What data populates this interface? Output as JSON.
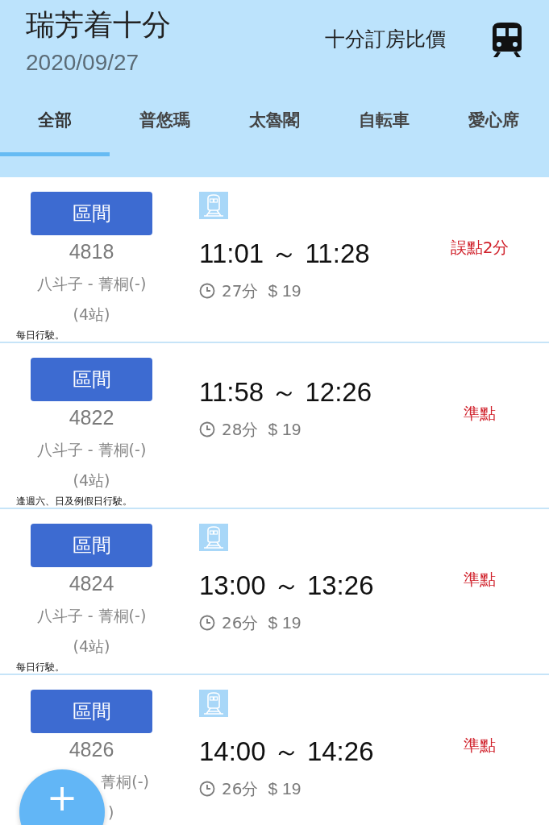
{
  "header": {
    "title": "瑞芳着十分",
    "date": "2020/09/27",
    "link": "十分訂房比價"
  },
  "tabs": [
    {
      "label": "全部",
      "selected": true
    },
    {
      "label": "普悠瑪",
      "selected": false
    },
    {
      "label": "太魯閣",
      "selected": false
    },
    {
      "label": "自転車",
      "selected": false
    },
    {
      "label": "愛心席",
      "selected": false
    }
  ],
  "trains": [
    {
      "type": "區間",
      "number": "4818",
      "route": "八斗子 - 菁桐(-)",
      "stops": "(4站)",
      "note": "每日行駛。",
      "train_icon": true,
      "times": "11:01 ～ 11:28",
      "duration": "27分",
      "fare": "$ 19",
      "status": "誤點2分",
      "covered_by_fab": false
    },
    {
      "type": "區間",
      "number": "4822",
      "route": "八斗子 - 菁桐(-)",
      "stops": "(4站)",
      "note": "逢週六、日及例假日行駛。",
      "train_icon": false,
      "times": "11:58 ～ 12:26",
      "duration": "28分",
      "fare": "$ 19",
      "status": "準點",
      "covered_by_fab": false
    },
    {
      "type": "區間",
      "number": "4824",
      "route": "八斗子 - 菁桐(-)",
      "stops": "(4站)",
      "note": "每日行駛。",
      "train_icon": true,
      "times": "13:00 ～ 13:26",
      "duration": "26分",
      "fare": "$ 19",
      "status": "準點",
      "covered_by_fab": false
    },
    {
      "type": "區間",
      "number": "4826",
      "route": "菁桐(-)",
      "stops": ")",
      "train_icon": true,
      "times": "14:00 ～ 14:26",
      "duration": "26分",
      "fare": "$ 19",
      "status": "準點",
      "covered_by_fab": true
    }
  ],
  "fab": {
    "label": "+"
  }
}
